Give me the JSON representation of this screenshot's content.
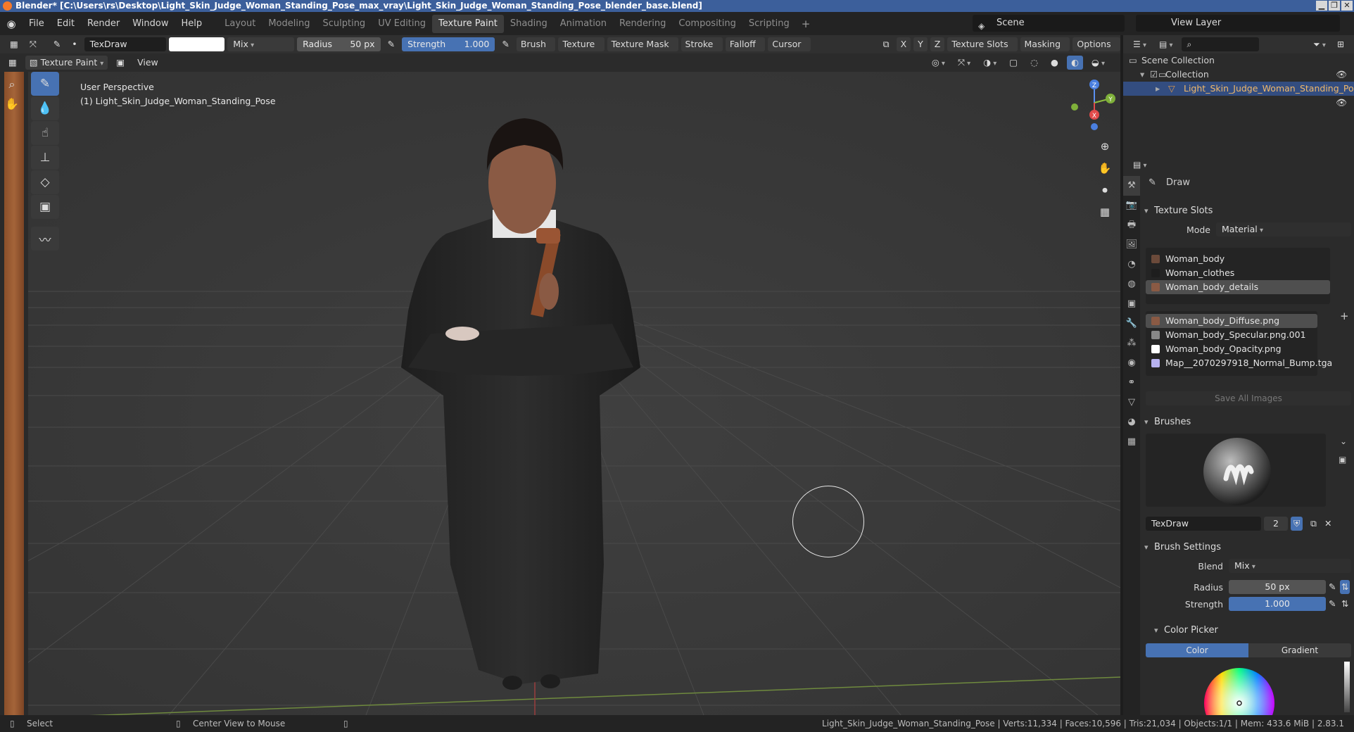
{
  "window": {
    "title": "Blender* [C:\\Users\\rs\\Desktop\\Light_Skin_Judge_Woman_Standing_Pose_max_vray\\Light_Skin_Judge_Woman_Standing_Pose_blender_base.blend]",
    "controls": [
      "▁",
      "❐",
      "✕"
    ]
  },
  "menu": [
    "File",
    "Edit",
    "Render",
    "Window",
    "Help"
  ],
  "workspaces": [
    {
      "label": "Layout",
      "active": false
    },
    {
      "label": "Modeling",
      "active": false
    },
    {
      "label": "Sculpting",
      "active": false
    },
    {
      "label": "UV Editing",
      "active": false
    },
    {
      "label": "Texture Paint",
      "active": true
    },
    {
      "label": "Shading",
      "active": false
    },
    {
      "label": "Animation",
      "active": false
    },
    {
      "label": "Rendering",
      "active": false
    },
    {
      "label": "Compositing",
      "active": false
    },
    {
      "label": "Scripting",
      "active": false
    }
  ],
  "scene": "Scene",
  "view_layer": "View Layer",
  "tool_header": {
    "brush_name": "TexDraw",
    "color": "#ffffff",
    "blend": "Mix",
    "radius_label": "Radius",
    "radius_value": "50 px",
    "strength_label": "Strength",
    "strength_value": "1.000",
    "axis": [
      "X",
      "Y",
      "Z"
    ],
    "menus": [
      "Brush",
      "Texture",
      "Texture Mask",
      "Stroke",
      "Falloff",
      "Cursor"
    ],
    "right_menus": [
      "Texture Slots",
      "Masking",
      "Options"
    ]
  },
  "mode_header": {
    "mode": "Texture Paint",
    "view": "View"
  },
  "viewport": {
    "perspective": "User Perspective",
    "object": "(1) Light_Skin_Judge_Woman_Standing_Pose",
    "gizmo": {
      "x": "X",
      "y": "Y",
      "z": "Z"
    }
  },
  "outliner": {
    "root": "Scene Collection",
    "collection": "Collection",
    "object": "Light_Skin_Judge_Woman_Standing_Pose"
  },
  "properties": {
    "tool": "Draw",
    "texture_slots_title": "Texture Slots",
    "mode_label": "Mode",
    "mode_value": "Material",
    "materials": [
      {
        "name": "Woman_body",
        "color": "#6b4a3a",
        "selected": false
      },
      {
        "name": "Woman_clothes",
        "color": "#1e1e1e",
        "selected": false
      },
      {
        "name": "Woman_body_details",
        "color": "#8a5a44",
        "selected": true
      }
    ],
    "images": [
      {
        "name": "Woman_body_Diffuse.png",
        "color": "#8a5a44",
        "selected": true
      },
      {
        "name": "Woman_body_Specular.png.001",
        "color": "#888888",
        "selected": false
      },
      {
        "name": "Woman_body_Opacity.png",
        "color": "#ffffff",
        "selected": false
      },
      {
        "name": "Map__2070297918_Normal_Bump.tga",
        "color": "#b7b2f0",
        "selected": false
      }
    ],
    "save_all": "Save All Images",
    "brushes_title": "Brushes",
    "brush_name": "TexDraw",
    "brush_users": "2",
    "brush_settings_title": "Brush Settings",
    "blend_label": "Blend",
    "blend_value": "Mix",
    "radius_label": "Radius",
    "radius_value": "50 px",
    "strength_label": "Strength",
    "strength_value": "1.000",
    "color_picker_title": "Color Picker",
    "color_tab": "Color",
    "gradient_tab": "Gradient"
  },
  "status": {
    "select": "Select",
    "center": "Center View to Mouse",
    "stats": "Light_Skin_Judge_Woman_Standing_Pose | Verts:11,334 | Faces:10,596 | Tris:21,034 | Objects:1/1 | Mem: 433.6 MiB | 2.83.1"
  }
}
